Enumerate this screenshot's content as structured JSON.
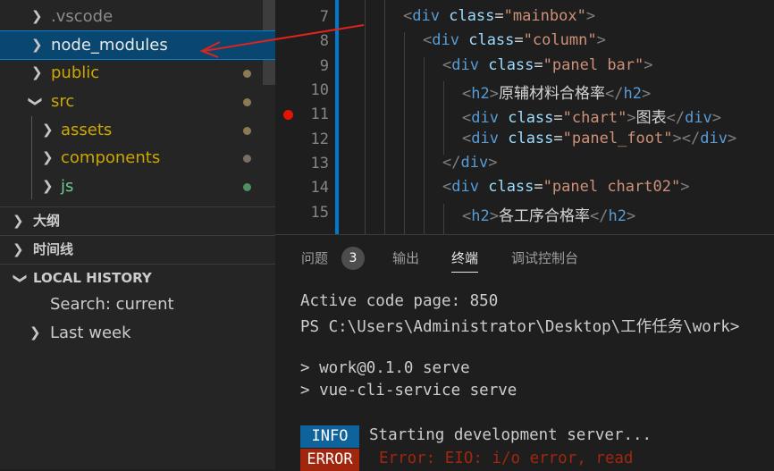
{
  "explorer": {
    "items": [
      {
        "label": ".vscode",
        "chevron": "chevron-right",
        "color": "#8b8b8b"
      },
      {
        "label": "node_modules",
        "chevron": "chevron-right",
        "color": "#e8e8e8"
      },
      {
        "label": "public",
        "chevron": "chevron-right",
        "color": "#cca700"
      },
      {
        "label": "src",
        "chevron": "chevron-down",
        "color": "#cca700"
      },
      {
        "label": "assets",
        "chevron": "chevron-right",
        "color": "#cca700"
      },
      {
        "label": "components",
        "chevron": "chevron-right",
        "color": "#cca700"
      },
      {
        "label": "js",
        "chevron": "chevron-right",
        "color": "#73c991"
      }
    ]
  },
  "sections": {
    "outline": "大纲",
    "timeline": "时间线",
    "local_history": "LOCAL HISTORY"
  },
  "local_history": {
    "search": "Search: current",
    "last_week": "Last week"
  },
  "editor": {
    "line_numbers": [
      "7",
      "8",
      "9",
      "10",
      "11",
      "12",
      "13",
      "14",
      "15"
    ],
    "lines": [
      {
        "tag": "div",
        "cls": "mainbox"
      },
      {
        "tag": "div",
        "cls": "column"
      },
      {
        "tag": "div",
        "cls": "panel bar"
      },
      {
        "tag": "h2",
        "text": "原辅材料合格率"
      },
      {
        "tag": "div",
        "cls": "chart",
        "text": "图表"
      },
      {
        "tag": "div",
        "cls": "panel_foot"
      },
      {
        "close": "div"
      },
      {
        "tag": "div",
        "cls": "panel chart02"
      },
      {
        "tag": "h2",
        "text": "各工序合格率"
      }
    ]
  },
  "panel": {
    "tabs": [
      "问题",
      "输出",
      "终端",
      "调试控制台"
    ],
    "problems_count": "3",
    "active_tab": "终端"
  },
  "terminal": {
    "line1": "Active code page: 850",
    "line2": "PS C:\\Users\\Administrator\\Desktop\\工作任务\\work>",
    "line3": "> work@0.1.0 serve",
    "line4": "> vue-cli-service serve",
    "info_tag": "INFO",
    "info_text": "Starting development server...",
    "error_tag": "ERROR",
    "error_text": "Error: EIO: i/o error, read"
  },
  "colors": {
    "accent": "#007acc",
    "selection": "#094771",
    "info_bg": "#0e639c",
    "error_bg": "#a1260d",
    "error_text": "#f14c4c",
    "modified_dot": "#8c7a57"
  }
}
